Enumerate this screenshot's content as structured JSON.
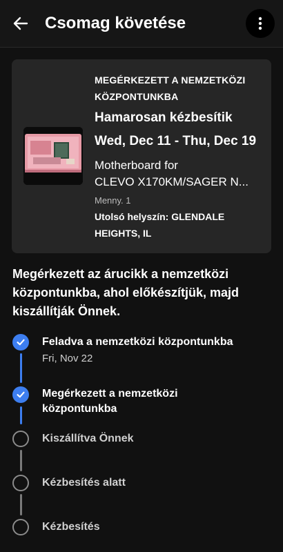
{
  "header": {
    "title": "Csomag követése"
  },
  "card": {
    "status": "MEGÉRKEZETT A NEMZETKÖZI KÖZPONTUNKBA",
    "headline": "Hamarosan kézbesítik",
    "date_range": "Wed, Dec 11 - Thu, Dec 19",
    "product_line1": "Motherboard for",
    "product_line2": "CLEVO X170KM/SAGER N...",
    "quantity": "Menny. 1",
    "last_location": "Utolsó helyszín: GLENDALE HEIGHTS, IL"
  },
  "description": "Megérkezett az árucikk a nemzetközi központunkba, ahol előkészítjük, majd kiszállítják Önnek.",
  "timeline": [
    {
      "label": "Feladva a nemzetközi központunkba",
      "date": "Fri, Nov 22",
      "state": "done"
    },
    {
      "label": "Megérkezett a nemzetközi központunkba",
      "state": "done"
    },
    {
      "label": "Kiszállítva Önnek",
      "state": "pending"
    },
    {
      "label": "Kézbesítés alatt",
      "state": "pending"
    },
    {
      "label": "Kézbesítés",
      "state": "pending"
    }
  ],
  "colors": {
    "accent": "#3d7ef0",
    "background": "#111111",
    "card": "#262626"
  }
}
